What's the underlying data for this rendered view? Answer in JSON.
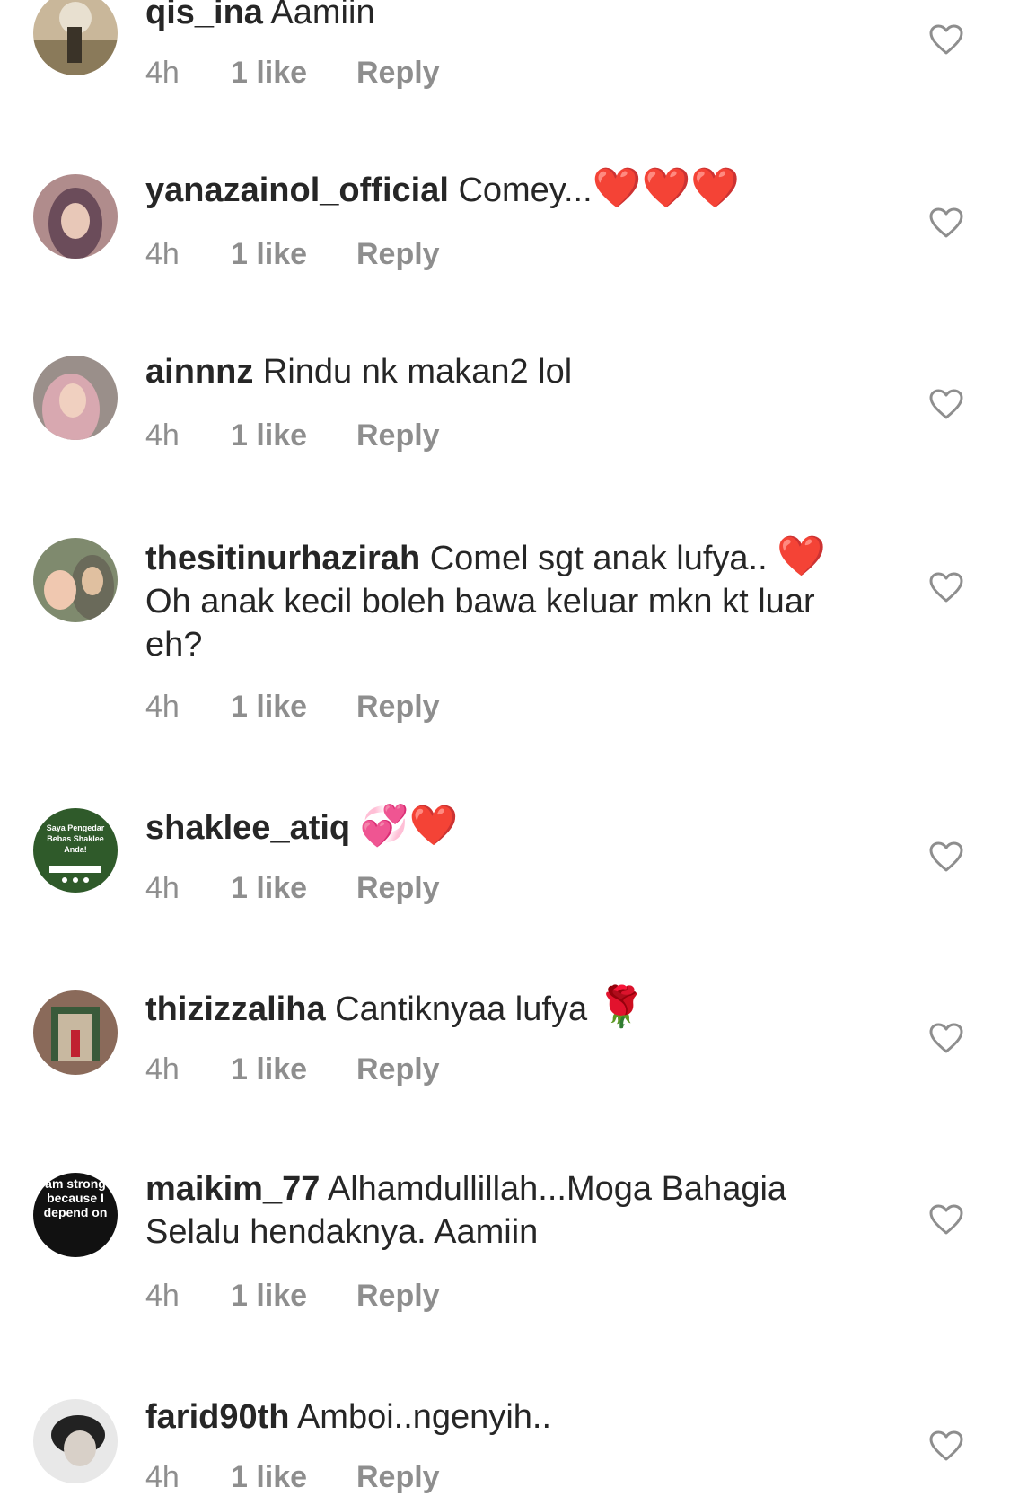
{
  "comments": [
    {
      "username": "qis_ina",
      "text": "Aamiin",
      "time": "4h",
      "likes": "1 like",
      "reply": "Reply"
    },
    {
      "username": "yanazainol_official",
      "text": "Comey...",
      "emoji": "❤️❤️❤️",
      "time": "4h",
      "likes": "1 like",
      "reply": "Reply"
    },
    {
      "username": "ainnnz",
      "text": "Rindu nk makan2 lol",
      "time": "4h",
      "likes": "1 like",
      "reply": "Reply"
    },
    {
      "username": "thesitinurhazirah",
      "text": "Comel sgt anak lufya..",
      "emoji": "❤️",
      "text2": "Oh anak kecil boleh bawa keluar mkn kt luar eh?",
      "time": "4h",
      "likes": "1 like",
      "reply": "Reply"
    },
    {
      "username": "shaklee_atiq",
      "emoji_pink": "💞",
      "emoji": "❤️",
      "time": "4h",
      "likes": "1 like",
      "reply": "Reply",
      "avatar_text": "Saya Pengedar Bebas Shaklee Anda!"
    },
    {
      "username": "thizizzaliha",
      "text": "Cantiknyaa lufya",
      "emoji_rose": "🌹",
      "time": "4h",
      "likes": "1 like",
      "reply": "Reply"
    },
    {
      "username": "maikim_77",
      "text": "Alhamdullillah...Moga Bahagia Selalu hendaknya. Aamiin",
      "time": "4h",
      "likes": "1 like",
      "reply": "Reply",
      "avatar_text": "am strong because I depend on"
    },
    {
      "username": "farid90th",
      "text": "Amboi..ngenyih..",
      "time": "4h",
      "likes": "1 like",
      "reply": "Reply"
    }
  ],
  "colors": {
    "text": "#262626",
    "meta": "#8e8e8e",
    "heart_outline": "#8e8e8e",
    "emoji_heart": "#e8202a"
  },
  "icons": {
    "like": "heart-outline-icon"
  }
}
